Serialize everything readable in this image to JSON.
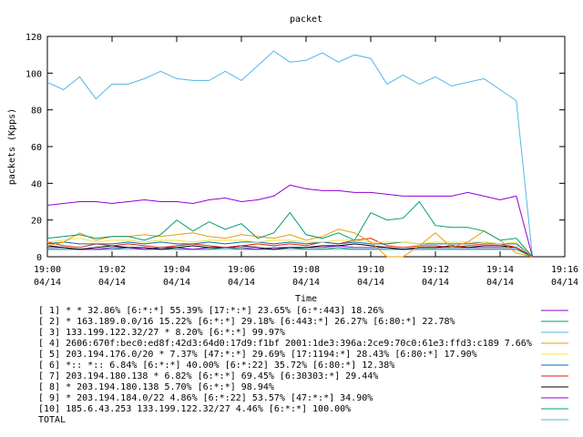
{
  "chart_data": {
    "type": "line",
    "title": "packet",
    "xlabel": "Time",
    "ylabel": "packets (Kpps)",
    "ylim": [
      0,
      120
    ],
    "yticks": [
      "0",
      "20",
      "40",
      "60",
      "80",
      "100",
      "120"
    ],
    "xticks": [
      {
        "time": "19:00",
        "date": "04/14"
      },
      {
        "time": "19:02",
        "date": "04/14"
      },
      {
        "time": "19:04",
        "date": "04/14"
      },
      {
        "time": "19:06",
        "date": "04/14"
      },
      {
        "time": "19:08",
        "date": "04/14"
      },
      {
        "time": "19:10",
        "date": "04/14"
      },
      {
        "time": "19:12",
        "date": "04/14"
      },
      {
        "time": "19:14",
        "date": "04/14"
      },
      {
        "time": "19:16",
        "date": "04/14"
      }
    ],
    "x": [
      "19:00:00",
      "19:00:30",
      "19:01:00",
      "19:01:30",
      "19:02:00",
      "19:02:30",
      "19:03:00",
      "19:03:30",
      "19:04:00",
      "19:04:30",
      "19:05:00",
      "19:05:30",
      "19:06:00",
      "19:06:30",
      "19:07:00",
      "19:07:30",
      "19:08:00",
      "19:08:30",
      "19:09:00",
      "19:09:30",
      "19:10:00",
      "19:10:30",
      "19:11:00",
      "19:11:30",
      "19:12:00",
      "19:12:30",
      "19:13:00",
      "19:13:30",
      "19:14:00",
      "19:14:30",
      "19:15:00"
    ],
    "grid": false,
    "legend_position": "bottom",
    "series": [
      {
        "name": "[ 1] * * 32.86%  [6:*:*] 55.39% [17:*:*] 23.65% [6:*:443] 18.26%",
        "color": "#9400d3",
        "values": [
          28,
          29,
          30,
          30,
          29,
          30,
          31,
          30,
          30,
          29,
          31,
          32,
          30,
          31,
          33,
          39,
          37,
          36,
          36,
          35,
          35,
          34,
          33,
          33,
          33,
          33,
          35,
          33,
          31,
          33,
          0
        ]
      },
      {
        "name": "[ 2] * 163.189.0.0/16 15.22%  [6:*:*] 29.18% [6:443:*] 26.27% [6:80:*] 22.78%",
        "color": "#009e73",
        "values": [
          10,
          11,
          12,
          10,
          11,
          11,
          9,
          12,
          20,
          14,
          19,
          15,
          18,
          10,
          13,
          24,
          12,
          10,
          13,
          9,
          24,
          20,
          21,
          30,
          17,
          16,
          16,
          14,
          9,
          10,
          0
        ]
      },
      {
        "name": "[ 3] 133.199.122.32/27 * 8.20%  [6:*:*] 99.97%",
        "color": "#56b4e9",
        "values": [
          95,
          91,
          98,
          86,
          94,
          94,
          97,
          101,
          97,
          96,
          96,
          101,
          96,
          104,
          112,
          106,
          107,
          111,
          106,
          110,
          108,
          94,
          99,
          94,
          98,
          93,
          95,
          97,
          91,
          85,
          0
        ]
      },
      {
        "name": "[ 4] 2606:670f:bec0:ed8f:42d3:64d0:17d9:f1bf 2001:1de3:396a:2ce9:70c0:61e3:ffd3:c189 7.66%",
        "color": "#e69f00",
        "values": [
          6,
          8,
          13,
          9,
          11,
          11,
          12,
          11,
          12,
          13,
          11,
          10,
          12,
          11,
          10,
          12,
          9,
          11,
          15,
          13,
          8,
          0,
          0,
          6,
          13,
          5,
          8,
          14,
          9,
          2,
          0
        ]
      },
      {
        "name": "[ 5] 203.194.176.0/20 * 7.37%  [47:*:*] 29.69% [17:1194:*] 28.43% [6:80:*] 17.90%",
        "color": "#f0e442",
        "values": [
          8,
          9,
          10,
          8,
          9,
          9,
          8,
          9,
          9,
          8,
          9,
          9,
          9,
          8,
          9,
          9,
          8,
          8,
          9,
          9,
          8,
          8,
          8,
          7,
          8,
          8,
          8,
          8,
          7,
          8,
          0
        ]
      },
      {
        "name": "[ 6] *:: *:: 6.84%  [6:*:*] 40.00% [6:*:22] 35.72% [6:80:*] 12.38%",
        "color": "#0072b2",
        "values": [
          7,
          8,
          7,
          7,
          7,
          8,
          7,
          8,
          7,
          7,
          8,
          7,
          8,
          8,
          7,
          8,
          7,
          8,
          7,
          8,
          7,
          7,
          8,
          7,
          7,
          7,
          7,
          8,
          7,
          7,
          0
        ]
      },
      {
        "name": "[ 7] 203.194.180.138 * 6.82%  [6:*:*] 69.45% [6:30303:*] 29.44%",
        "color": "#e51e10",
        "values": [
          8,
          6,
          5,
          7,
          6,
          7,
          6,
          5,
          6,
          7,
          6,
          5,
          6,
          7,
          6,
          7,
          6,
          8,
          7,
          9,
          10,
          6,
          5,
          6,
          6,
          5,
          6,
          7,
          7,
          5,
          0
        ]
      },
      {
        "name": "[ 8] * 203.194.180.138 5.70%  [6:*:*] 98.94%",
        "color": "#000000",
        "values": [
          6,
          5,
          4,
          5,
          6,
          5,
          5,
          4,
          5,
          6,
          5,
          5,
          6,
          5,
          4,
          5,
          5,
          6,
          6,
          7,
          6,
          5,
          4,
          5,
          5,
          6,
          5,
          6,
          6,
          5,
          0
        ]
      },
      {
        "name": "[ 9] * 203.194.184.0/22 4.86%  [6:*:22] 53.57% [47:*:*] 34.90%",
        "color": "#9400d3",
        "values": [
          5,
          5,
          4,
          4,
          5,
          5,
          4,
          5,
          5,
          4,
          5,
          5,
          5,
          4,
          5,
          5,
          5,
          5,
          6,
          5,
          5,
          5,
          4,
          5,
          5,
          5,
          5,
          5,
          5,
          5,
          0
        ]
      },
      {
        "name": "[10] 185.6.43.253 133.199.122.32/27 4.46%  [6:*:*] 100.00%",
        "color": "#009e73",
        "values": [
          4,
          4,
          4,
          4,
          4,
          5,
          4,
          4,
          4,
          4,
          4,
          5,
          4,
          4,
          4,
          5,
          4,
          4,
          5,
          4,
          4,
          4,
          4,
          4,
          4,
          4,
          4,
          4,
          4,
          4,
          0
        ]
      },
      {
        "name": "TOTAL",
        "color": "#56b4e9",
        "values": [
          4,
          4,
          4,
          4,
          4,
          4,
          4,
          4,
          4,
          4,
          4,
          4,
          4,
          4,
          4,
          4,
          4,
          4,
          4,
          4,
          4,
          4,
          4,
          4,
          4,
          4,
          4,
          4,
          4,
          4,
          0
        ]
      }
    ]
  }
}
